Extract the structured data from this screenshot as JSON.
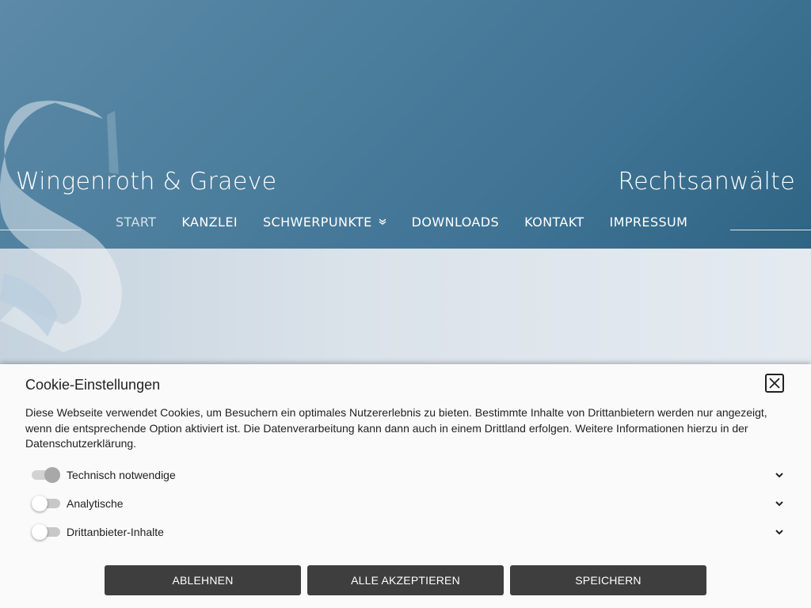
{
  "header": {
    "brand_name": "Wingenroth & Graeve",
    "tagline": "Rechtsanwälte",
    "nav": [
      {
        "label": "START",
        "active": true
      },
      {
        "label": "KANZLEI"
      },
      {
        "label": "SCHWERPUNKTE",
        "has_dropdown": true,
        "icon": "chevron-double-down-icon"
      },
      {
        "label": "DOWNLOADS"
      },
      {
        "label": "KONTAKT"
      },
      {
        "label": "IMPRESSUM"
      }
    ]
  },
  "cookie_banner": {
    "title": "Cookie-Einstellungen",
    "text": "Diese Webseite verwendet Cookies, um Besuchern ein optimales Nutzererlebnis zu bieten. Bestimmte Inhalte von Drittanbietern werden nur angezeigt, wenn die entsprechende Option aktiviert ist. Die Datenverarbeitung kann dann auch in einem Drittland erfolgen. Weitere Informationen hierzu in der Datenschutzerklärung.",
    "close_icon": "close-icon",
    "options": [
      {
        "label": "Technisch notwendige",
        "enabled": true,
        "locked": true
      },
      {
        "label": "Analytische",
        "enabled": false
      },
      {
        "label": "Drittanbieter-Inhalte",
        "enabled": false
      }
    ],
    "buttons": {
      "reject": "ABLEHNEN",
      "accept_all": "ALLE AKZEPTIEREN",
      "save": "SPEICHERN"
    }
  },
  "colors": {
    "header_blue": "#4b7d9c",
    "button_dark": "#3e3e3e",
    "banner_bg": "#fafafa"
  }
}
